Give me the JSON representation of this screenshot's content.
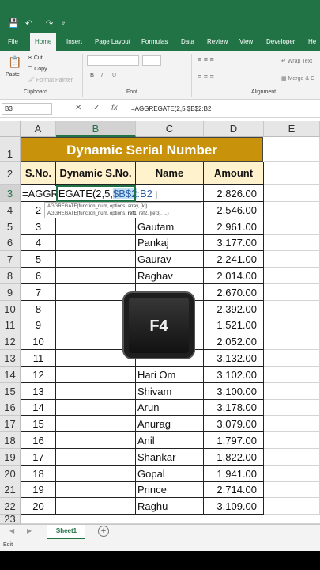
{
  "qat": {
    "save_icon": "save-icon",
    "undo_icon": "undo-icon",
    "redo_icon": "redo-icon",
    "customize_icon": "customize-qat-icon"
  },
  "ribbon_tabs": [
    "File",
    "Home",
    "Insert",
    "Page Layout",
    "Formulas",
    "Data",
    "Review",
    "View",
    "Developer",
    "He"
  ],
  "ribbon": {
    "paste": "Paste",
    "cut": "Cut",
    "copy": "Copy",
    "format_painter": "Format Painter",
    "clipboard": "Clipboard",
    "font": "Font",
    "bold": "B",
    "italic": "I",
    "underline": "U",
    "wrap_text": "Wrap Text",
    "merge": "Merge & C",
    "alignment": "Alignment"
  },
  "formula_bar": {
    "name_box": "B3",
    "cancel": "✕",
    "enter": "✓",
    "fx": "fx",
    "formula": "=AGGREGATE(2,5,$B$2:B2"
  },
  "columns": [
    "A",
    "B",
    "C",
    "D",
    "E"
  ],
  "rows": [
    "1",
    "2",
    "3",
    "4",
    "5",
    "6",
    "7",
    "8",
    "9",
    "10",
    "11",
    "12",
    "13",
    "14",
    "15",
    "16",
    "17",
    "18",
    "19",
    "20",
    "21",
    "22",
    "23"
  ],
  "title": "Dynamic Serial Number",
  "headers": {
    "sno": "S.No.",
    "dyn": "Dynamic S.No.",
    "name": "Name",
    "amount": "Amount"
  },
  "editing": {
    "prefix": "=AGGREGATE(2,5,",
    "ref_abs": "$B$2",
    "ref_rel": ":B2"
  },
  "tooltip": {
    "line1": "AGGREGATE(function_num, options, array, [k])",
    "line2_pre": "AGGREGATE(function_num, options, ",
    "line2_bold": "ref1",
    "line2_post": ", ref2, [ref3], ...)"
  },
  "data_rows": [
    {
      "sno": "",
      "name": "",
      "amount": "2,826.00"
    },
    {
      "sno": "2",
      "name": "",
      "amount": "2,546.00"
    },
    {
      "sno": "3",
      "name": "Gautam",
      "amount": "2,961.00"
    },
    {
      "sno": "4",
      "name": "Pankaj",
      "amount": "3,177.00"
    },
    {
      "sno": "5",
      "name": "Gaurav",
      "amount": "2,241.00"
    },
    {
      "sno": "6",
      "name": "Raghav",
      "amount": "2,014.00"
    },
    {
      "sno": "7",
      "name": "",
      "amount": "2,670.00"
    },
    {
      "sno": "8",
      "name": "",
      "amount": "2,392.00"
    },
    {
      "sno": "9",
      "name": "",
      "amount": "1,521.00"
    },
    {
      "sno": "10",
      "name": "",
      "amount": "2,052.00"
    },
    {
      "sno": "11",
      "name": "",
      "amount": "3,132.00"
    },
    {
      "sno": "12",
      "name": "Hari Om",
      "amount": "3,102.00"
    },
    {
      "sno": "13",
      "name": "Shivam",
      "amount": "3,100.00"
    },
    {
      "sno": "14",
      "name": "Arun",
      "amount": "3,178.00"
    },
    {
      "sno": "15",
      "name": "Anurag",
      "amount": "3,079.00"
    },
    {
      "sno": "16",
      "name": "Anil",
      "amount": "1,797.00"
    },
    {
      "sno": "17",
      "name": "Shankar",
      "amount": "1,822.00"
    },
    {
      "sno": "18",
      "name": "Gopal",
      "amount": "1,941.00"
    },
    {
      "sno": "19",
      "name": "Prince",
      "amount": "2,714.00"
    },
    {
      "sno": "20",
      "name": "Raghu",
      "amount": "3,109.00"
    }
  ],
  "key_overlay": "F4",
  "sheet_tab": "Sheet1",
  "status": "Edit",
  "colors": {
    "excel_green": "#217346",
    "title_fill": "#c8930a",
    "header_fill": "#fff2cc"
  }
}
